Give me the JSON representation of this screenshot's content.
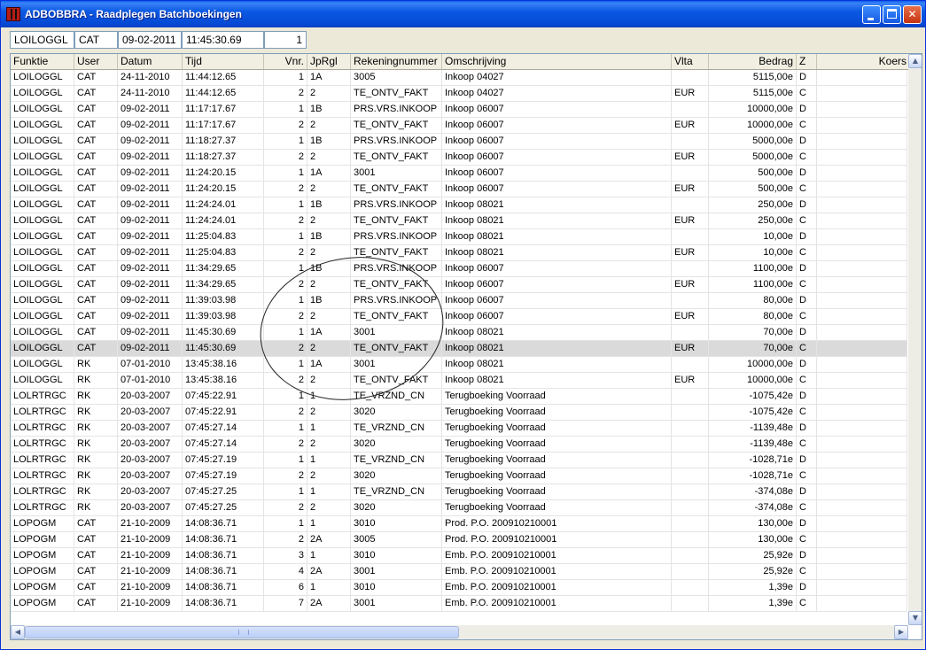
{
  "window": {
    "title": "ADBOBBRA - Raadplegen Batchboekingen"
  },
  "info_bar": {
    "funktie": "LOILOGGL",
    "user": "CAT",
    "datum": "09-02-2011",
    "tijd": "11:45:30.69",
    "vnr": "1"
  },
  "columns": [
    "Funktie",
    "User",
    "Datum",
    "Tijd",
    "Vnr.",
    "JpRgl",
    "Rekeningnummer",
    "Omschrijving",
    "Vlta",
    "Bedrag",
    "Z",
    "Koers"
  ],
  "selected_row": 17,
  "rows": [
    [
      "LOILOGGL",
      "CAT",
      "24-11-2010",
      "11:44:12.65",
      "1",
      "1A",
      "3005",
      "Inkoop 04027",
      "",
      "5115,00e",
      "D",
      ""
    ],
    [
      "LOILOGGL",
      "CAT",
      "24-11-2010",
      "11:44:12.65",
      "2",
      "2",
      "TE_ONTV_FAKT",
      "Inkoop 04027",
      "EUR",
      "5115,00e",
      "C",
      ""
    ],
    [
      "LOILOGGL",
      "CAT",
      "09-02-2011",
      "11:17:17.67",
      "1",
      "1B",
      "PRS.VRS.INKOOP",
      "Inkoop 06007",
      "",
      "10000,00e",
      "D",
      ""
    ],
    [
      "LOILOGGL",
      "CAT",
      "09-02-2011",
      "11:17:17.67",
      "2",
      "2",
      "TE_ONTV_FAKT",
      "Inkoop 06007",
      "EUR",
      "10000,00e",
      "C",
      ""
    ],
    [
      "LOILOGGL",
      "CAT",
      "09-02-2011",
      "11:18:27.37",
      "1",
      "1B",
      "PRS.VRS.INKOOP",
      "Inkoop 06007",
      "",
      "5000,00e",
      "D",
      ""
    ],
    [
      "LOILOGGL",
      "CAT",
      "09-02-2011",
      "11:18:27.37",
      "2",
      "2",
      "TE_ONTV_FAKT",
      "Inkoop 06007",
      "EUR",
      "5000,00e",
      "C",
      ""
    ],
    [
      "LOILOGGL",
      "CAT",
      "09-02-2011",
      "11:24:20.15",
      "1",
      "1A",
      "3001",
      "Inkoop 06007",
      "",
      "500,00e",
      "D",
      ""
    ],
    [
      "LOILOGGL",
      "CAT",
      "09-02-2011",
      "11:24:20.15",
      "2",
      "2",
      "TE_ONTV_FAKT",
      "Inkoop 06007",
      "EUR",
      "500,00e",
      "C",
      ""
    ],
    [
      "LOILOGGL",
      "CAT",
      "09-02-2011",
      "11:24:24.01",
      "1",
      "1B",
      "PRS.VRS.INKOOP",
      "Inkoop 08021",
      "",
      "250,00e",
      "D",
      ""
    ],
    [
      "LOILOGGL",
      "CAT",
      "09-02-2011",
      "11:24:24.01",
      "2",
      "2",
      "TE_ONTV_FAKT",
      "Inkoop 08021",
      "EUR",
      "250,00e",
      "C",
      ""
    ],
    [
      "LOILOGGL",
      "CAT",
      "09-02-2011",
      "11:25:04.83",
      "1",
      "1B",
      "PRS.VRS.INKOOP",
      "Inkoop 08021",
      "",
      "10,00e",
      "D",
      ""
    ],
    [
      "LOILOGGL",
      "CAT",
      "09-02-2011",
      "11:25:04.83",
      "2",
      "2",
      "TE_ONTV_FAKT",
      "Inkoop 08021",
      "EUR",
      "10,00e",
      "C",
      ""
    ],
    [
      "LOILOGGL",
      "CAT",
      "09-02-2011",
      "11:34:29.65",
      "1",
      "1B",
      "PRS.VRS.INKOOP",
      "Inkoop 06007",
      "",
      "1100,00e",
      "D",
      ""
    ],
    [
      "LOILOGGL",
      "CAT",
      "09-02-2011",
      "11:34:29.65",
      "2",
      "2",
      "TE_ONTV_FAKT",
      "Inkoop 06007",
      "EUR",
      "1100,00e",
      "C",
      ""
    ],
    [
      "LOILOGGL",
      "CAT",
      "09-02-2011",
      "11:39:03.98",
      "1",
      "1B",
      "PRS.VRS.INKOOP",
      "Inkoop 06007",
      "",
      "80,00e",
      "D",
      ""
    ],
    [
      "LOILOGGL",
      "CAT",
      "09-02-2011",
      "11:39:03.98",
      "2",
      "2",
      "TE_ONTV_FAKT",
      "Inkoop 06007",
      "EUR",
      "80,00e",
      "C",
      ""
    ],
    [
      "LOILOGGL",
      "CAT",
      "09-02-2011",
      "11:45:30.69",
      "1",
      "1A",
      "3001",
      "Inkoop 08021",
      "",
      "70,00e",
      "D",
      ""
    ],
    [
      "LOILOGGL",
      "CAT",
      "09-02-2011",
      "11:45:30.69",
      "2",
      "2",
      "TE_ONTV_FAKT",
      "Inkoop 08021",
      "EUR",
      "70,00e",
      "C",
      ""
    ],
    [
      "LOILOGGL",
      "RK",
      "07-01-2010",
      "13:45:38.16",
      "1",
      "1A",
      "3001",
      "Inkoop 08021",
      "",
      "10000,00e",
      "D",
      ""
    ],
    [
      "LOILOGGL",
      "RK",
      "07-01-2010",
      "13:45:38.16",
      "2",
      "2",
      "TE_ONTV_FAKT",
      "Inkoop 08021",
      "EUR",
      "10000,00e",
      "C",
      ""
    ],
    [
      "LOLRTRGC",
      "RK",
      "20-03-2007",
      "07:45:22.91",
      "1",
      "1",
      "TE_VRZND_CN",
      "Terugboeking Voorraad",
      "",
      "-1075,42e",
      "D",
      ""
    ],
    [
      "LOLRTRGC",
      "RK",
      "20-03-2007",
      "07:45:22.91",
      "2",
      "2",
      "3020",
      "Terugboeking Voorraad",
      "",
      "-1075,42e",
      "C",
      ""
    ],
    [
      "LOLRTRGC",
      "RK",
      "20-03-2007",
      "07:45:27.14",
      "1",
      "1",
      "TE_VRZND_CN",
      "Terugboeking Voorraad",
      "",
      "-1139,48e",
      "D",
      ""
    ],
    [
      "LOLRTRGC",
      "RK",
      "20-03-2007",
      "07:45:27.14",
      "2",
      "2",
      "3020",
      "Terugboeking Voorraad",
      "",
      "-1139,48e",
      "C",
      ""
    ],
    [
      "LOLRTRGC",
      "RK",
      "20-03-2007",
      "07:45:27.19",
      "1",
      "1",
      "TE_VRZND_CN",
      "Terugboeking Voorraad",
      "",
      "-1028,71e",
      "D",
      ""
    ],
    [
      "LOLRTRGC",
      "RK",
      "20-03-2007",
      "07:45:27.19",
      "2",
      "2",
      "3020",
      "Terugboeking Voorraad",
      "",
      "-1028,71e",
      "C",
      ""
    ],
    [
      "LOLRTRGC",
      "RK",
      "20-03-2007",
      "07:45:27.25",
      "1",
      "1",
      "TE_VRZND_CN",
      "Terugboeking Voorraad",
      "",
      "-374,08e",
      "D",
      ""
    ],
    [
      "LOLRTRGC",
      "RK",
      "20-03-2007",
      "07:45:27.25",
      "2",
      "2",
      "3020",
      "Terugboeking Voorraad",
      "",
      "-374,08e",
      "C",
      ""
    ],
    [
      "LOPOGM",
      "CAT",
      "21-10-2009",
      "14:08:36.71",
      "1",
      "1",
      "3010",
      "Prod. P.O. 200910210001",
      "",
      "130,00e",
      "D",
      ""
    ],
    [
      "LOPOGM",
      "CAT",
      "21-10-2009",
      "14:08:36.71",
      "2",
      "2A",
      "3005",
      "Prod. P.O. 200910210001",
      "",
      "130,00e",
      "C",
      ""
    ],
    [
      "LOPOGM",
      "CAT",
      "21-10-2009",
      "14:08:36.71",
      "3",
      "1",
      "3010",
      "Emb. P.O. 200910210001",
      "",
      "25,92e",
      "D",
      ""
    ],
    [
      "LOPOGM",
      "CAT",
      "21-10-2009",
      "14:08:36.71",
      "4",
      "2A",
      "3001",
      "Emb. P.O. 200910210001",
      "",
      "25,92e",
      "C",
      ""
    ],
    [
      "LOPOGM",
      "CAT",
      "21-10-2009",
      "14:08:36.71",
      "6",
      "1",
      "3010",
      "Emb. P.O. 200910210001",
      "",
      "1,39e",
      "D",
      ""
    ],
    [
      "LOPOGM",
      "CAT",
      "21-10-2009",
      "14:08:36.71",
      "7",
      "2A",
      "3001",
      "Emb. P.O. 200910210001",
      "",
      "1,39e",
      "C",
      ""
    ]
  ]
}
